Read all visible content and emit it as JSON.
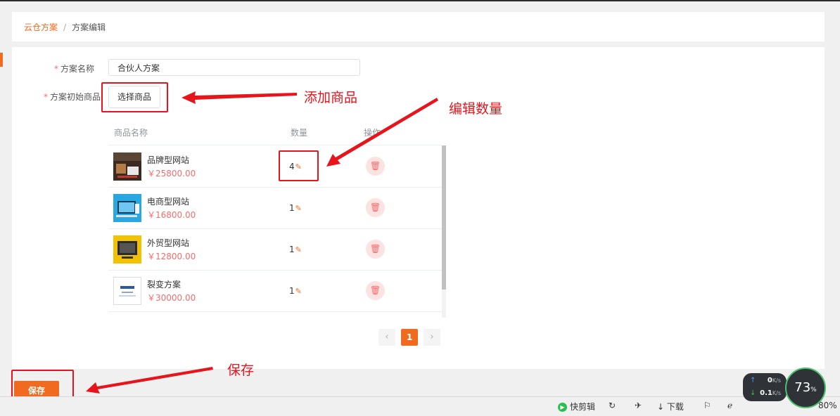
{
  "breadcrumb": {
    "root": "云仓方案",
    "separator": "/",
    "current": "方案编辑"
  },
  "form": {
    "required_mark": "*",
    "name_label": "方案名称",
    "name_value": "合伙人方案",
    "goods_label": "方案初始商品",
    "select_goods_button": "选择商品"
  },
  "table": {
    "headers": {
      "name": "商品名称",
      "quantity": "数量",
      "action": "操作"
    },
    "rows": [
      {
        "name": "品牌型网站",
        "price": "￥25800.00",
        "quantity": "4"
      },
      {
        "name": "电商型网站",
        "price": "￥16800.00",
        "quantity": "1"
      },
      {
        "name": "外贸型网站",
        "price": "￥12800.00",
        "quantity": "1"
      },
      {
        "name": "裂变方案",
        "price": "￥30000.00",
        "quantity": "1"
      }
    ]
  },
  "pagination": {
    "prev": "‹",
    "current": "1",
    "next": "›"
  },
  "save_button": "保存",
  "annotations": {
    "add_goods": "添加商品",
    "edit_quantity": "编辑数量",
    "save": "保存"
  },
  "taskbar": {
    "quick_edit": "快剪辑",
    "download": "下载",
    "upload_speed": "0",
    "download_speed": "0.1",
    "speed_unit": "K/s",
    "cpu": "73",
    "cpu_unit": "%",
    "zoom": "80%"
  },
  "colors": {
    "accent": "#f06a20",
    "price": "#f56c6c",
    "annotation": "#e8141c"
  }
}
